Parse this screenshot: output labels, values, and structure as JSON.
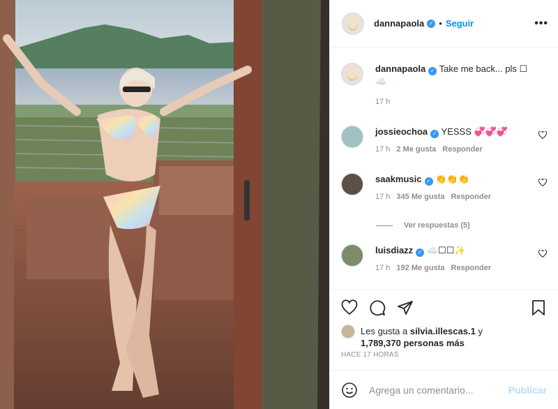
{
  "post": {
    "image_alt": "Photo of woman posing on a deck with a lake and hills in background",
    "author": "dannapaola",
    "follow_label": "Seguir",
    "dot": "•",
    "more_label": "•••"
  },
  "caption": {
    "user": "dannapaola",
    "text": "Take me back... pls ☐",
    "text2": "☁️",
    "time": "17 h"
  },
  "comments": [
    {
      "user": "jossieochoa",
      "text": "YESSS 💞💞💞",
      "time": "17 h",
      "likes": "2 Me gusta",
      "reply": "Responder"
    },
    {
      "user": "saakmusic",
      "text": "👏👏👏",
      "time": "17 h",
      "likes": "345 Me gusta",
      "reply": "Responder"
    },
    {
      "user": "luisdiazz",
      "text": "☁️☐☐✨",
      "time": "17 h",
      "likes": "192 Me gusta",
      "reply": "Responder"
    }
  ],
  "view_replies": "Ver respuestas (5)",
  "likes": {
    "prefix": "Les gusta a",
    "user": "silvia.illescas.1",
    "and": "y",
    "count": "1,789,370 personas más"
  },
  "timestamp": "HACE 17 HORAS",
  "add_comment": {
    "placeholder": "Agrega un comentario...",
    "publish": "Publicar"
  },
  "colors": {
    "accent": "#0095f6",
    "verified": "#3897f0",
    "muted": "#8e8e8e"
  }
}
